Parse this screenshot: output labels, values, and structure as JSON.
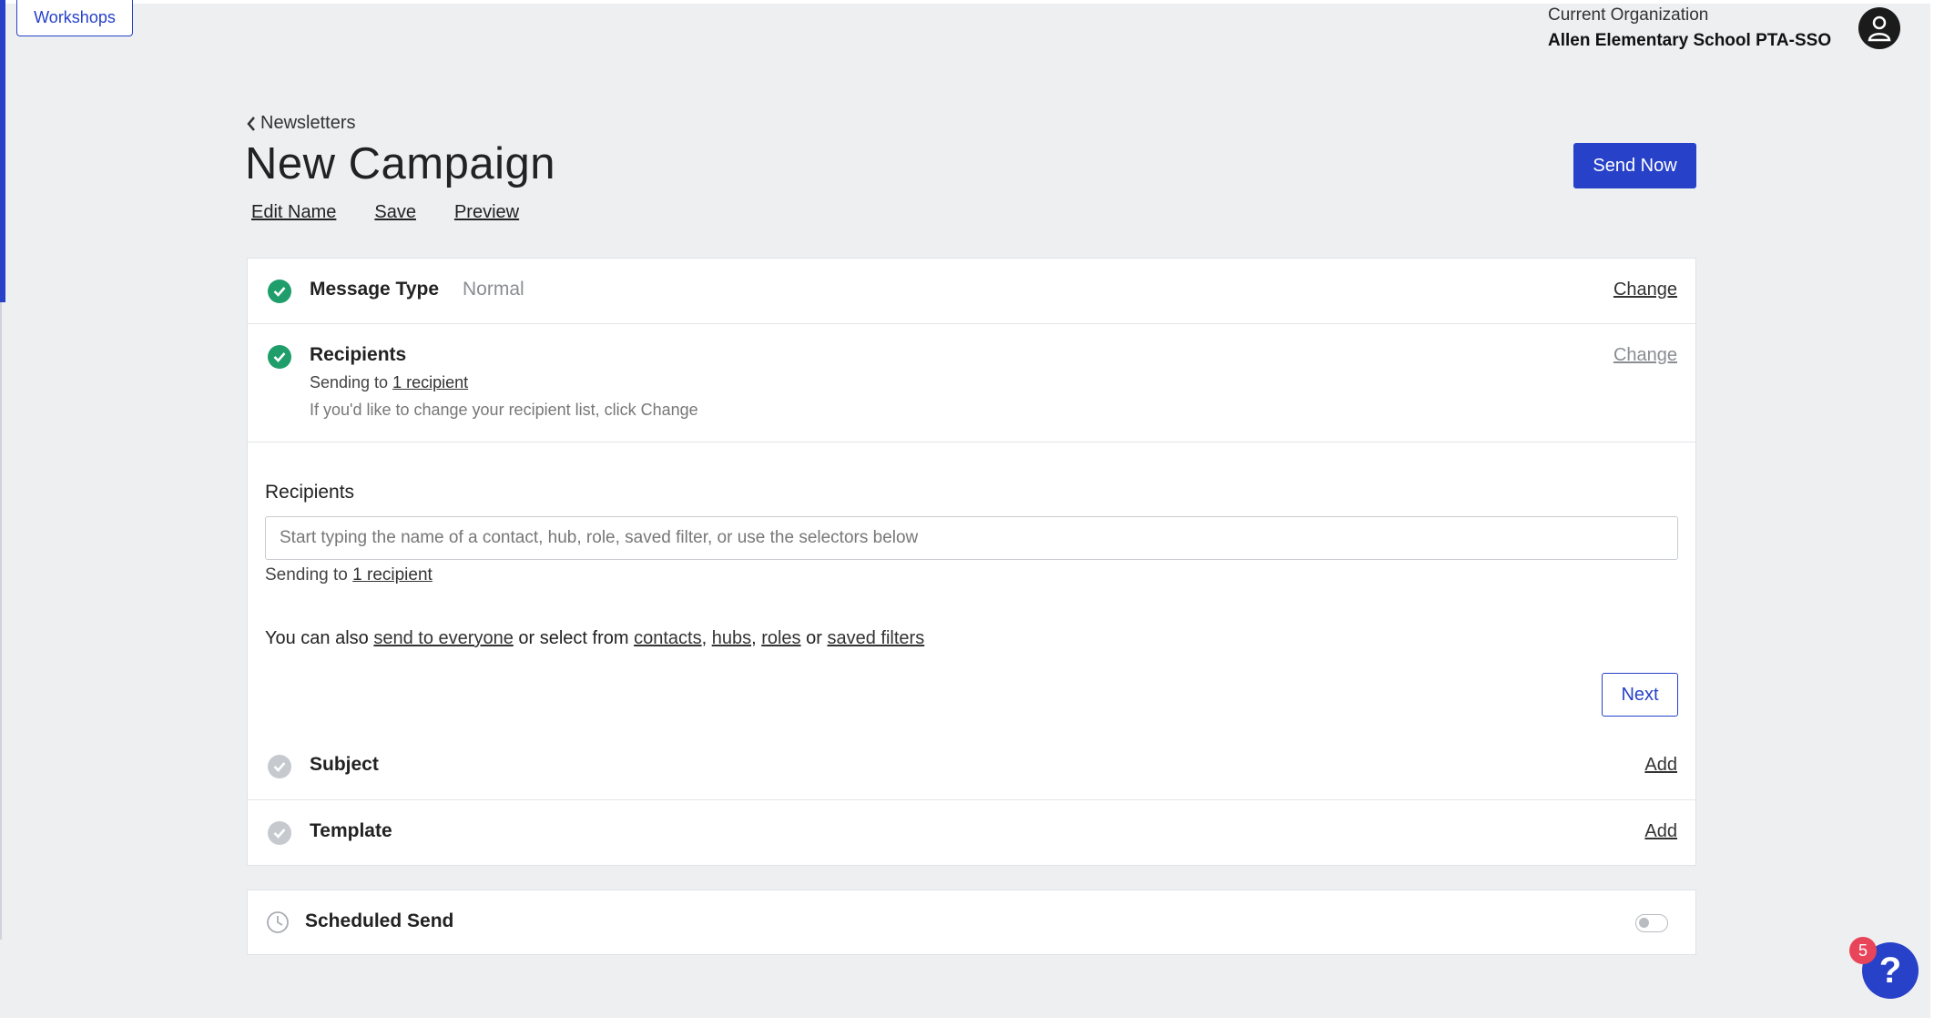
{
  "topbar": {
    "workshops_label": "Workshops",
    "org_label": "Current Organization",
    "org_name": "Allen Elementary School PTA-SSO",
    "avatar_icon": "user-avatar-icon"
  },
  "header": {
    "breadcrumb": "Newsletters",
    "title": "New Campaign",
    "actions": [
      "Edit Name",
      "Save",
      "Preview"
    ],
    "send_now": "Send Now"
  },
  "steps": {
    "message_type": {
      "title": "Message Type",
      "value": "Normal",
      "action": "Change",
      "status": "complete"
    },
    "recipients": {
      "title": "Recipients",
      "sending_prefix": "Sending to",
      "sending_link": "1 recipient",
      "hint": "If you'd like to change your recipient list, click Change",
      "action": "Change",
      "status": "complete"
    },
    "subject": {
      "title": "Subject",
      "action": "Add",
      "status": "incomplete"
    },
    "template": {
      "title": "Template",
      "action": "Add",
      "status": "incomplete"
    }
  },
  "recipients_editor": {
    "label": "Recipients",
    "placeholder": "Start typing the name of a contact, hub, role, saved filter, or use the selectors below",
    "sending_prefix": "Sending to",
    "sending_link": "1 recipient",
    "also_prefix": "You can also",
    "send_everyone": "send to everyone",
    "or_select": "or select from",
    "contacts": "contacts",
    "hubs": "hubs",
    "roles": "roles",
    "or": "or",
    "saved_filters": "saved filters",
    "next": "Next"
  },
  "scheduled": {
    "title": "Scheduled Send",
    "enabled": false
  },
  "help": {
    "badge": "5",
    "label": "?"
  },
  "colors": {
    "accent": "#2741c8",
    "success": "#1f9d6b",
    "badge": "#e8455a"
  }
}
